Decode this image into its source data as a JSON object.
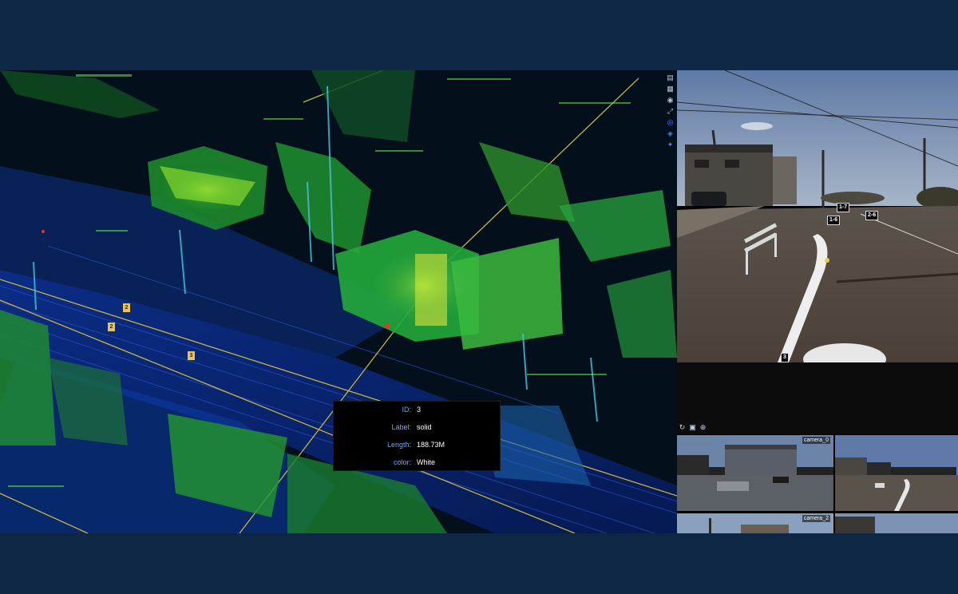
{
  "info_panel": {
    "rows": [
      {
        "key": "ID:",
        "value": "3"
      },
      {
        "key": "Label:",
        "value": "solid"
      },
      {
        "key": "Length:",
        "value": "188.73M"
      },
      {
        "key": "color:",
        "value": "White"
      }
    ]
  },
  "viewport_markers": [
    "2",
    "2",
    "3"
  ],
  "toolbar": {
    "icons": [
      "layers-icon",
      "calendar-icon",
      "eye-icon",
      "expand-icon",
      "target-icon",
      "cube-icon",
      "settings-icon"
    ]
  },
  "main_camera": {
    "tags": [
      "1-7",
      "1-6",
      "2-6",
      "3"
    ]
  },
  "thumb_toolbar": {
    "icons": [
      "rotate-icon",
      "fit-icon",
      "zoom-in-icon"
    ]
  },
  "thumbnails": [
    {
      "label": "camera_0"
    },
    {
      "label": ""
    },
    {
      "label": "camera_2"
    },
    {
      "label": ""
    }
  ]
}
